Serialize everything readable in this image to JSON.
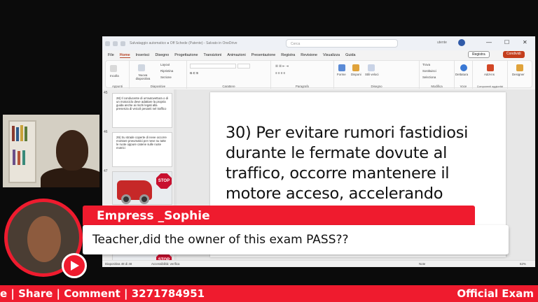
{
  "window": {
    "title": "Salvataggio automatico  ● Off  Schede (Patente) - Salvato in OneDrive",
    "search_placeholder": "Cerca",
    "user": "utente",
    "controls": [
      "—",
      "☐",
      "✕"
    ]
  },
  "menu": {
    "items": [
      "File",
      "Home",
      "Inserisci",
      "Disegno",
      "Progettazione",
      "Transizioni",
      "Animazioni",
      "Presentazione",
      "Registra",
      "Revisione",
      "Visualizza",
      "Guida"
    ],
    "active": "Home",
    "record_label": "Registra",
    "share_label": "Condividi"
  },
  "ribbon": {
    "groups": [
      {
        "name": "Appunti",
        "items": [
          "Incolla"
        ]
      },
      {
        "name": "Diapositive",
        "items": [
          "Nuova diapositiva",
          "Layout",
          "Ripristina",
          "Sezione"
        ]
      },
      {
        "name": "Carattere",
        "items": []
      },
      {
        "name": "Paragrafo",
        "items": []
      },
      {
        "name": "Disegno",
        "items": [
          "Forme",
          "Disponi",
          "Stili veloci"
        ]
      },
      {
        "name": "Modifica",
        "items": [
          "Trova",
          "Sostituisci",
          "Seleziona"
        ]
      },
      {
        "name": "Voce",
        "items": [
          "Dettatura"
        ]
      },
      {
        "name": "Componenti aggiuntivi",
        "items": [
          "Add-ins"
        ]
      },
      {
        "name": "",
        "items": [
          "Designer"
        ]
      }
    ]
  },
  "thumbnails": [
    {
      "number": "45",
      "text": "28) Il conducente di un'autovettura o di un motociclo deve adattare la propria guida anche ai rischi legati alla presenza di veicoli pesanti nel traffico"
    },
    {
      "number": "46",
      "text": "29) Su strade coperte di neve occorre montare pneumatici per neve su tutte le ruote oppure catene sulle ruote motrici"
    },
    {
      "number": "47",
      "text": ""
    }
  ],
  "stop_sign_label": "STOP",
  "slide": {
    "text": "30) Per evitare rumori fastidiosi durante le fermate dovute al traffico, occorre mantenere il motore acceso, accelerando"
  },
  "status": {
    "slide_info": "Diapositiva 48 di 48",
    "accessibility": "Accessibilità: verifica",
    "notes": "Note",
    "zoom": "62%"
  },
  "comment": {
    "name": "Empress _Sophie",
    "message": "Teacher,did the owner of this exam PASS??"
  },
  "ticker": {
    "left": "e | Share | Comment | 3271784951",
    "right": "Official Exam"
  },
  "colors": {
    "accent_red": "#ef1b2e",
    "ppt_accent": "#c43e1c"
  }
}
